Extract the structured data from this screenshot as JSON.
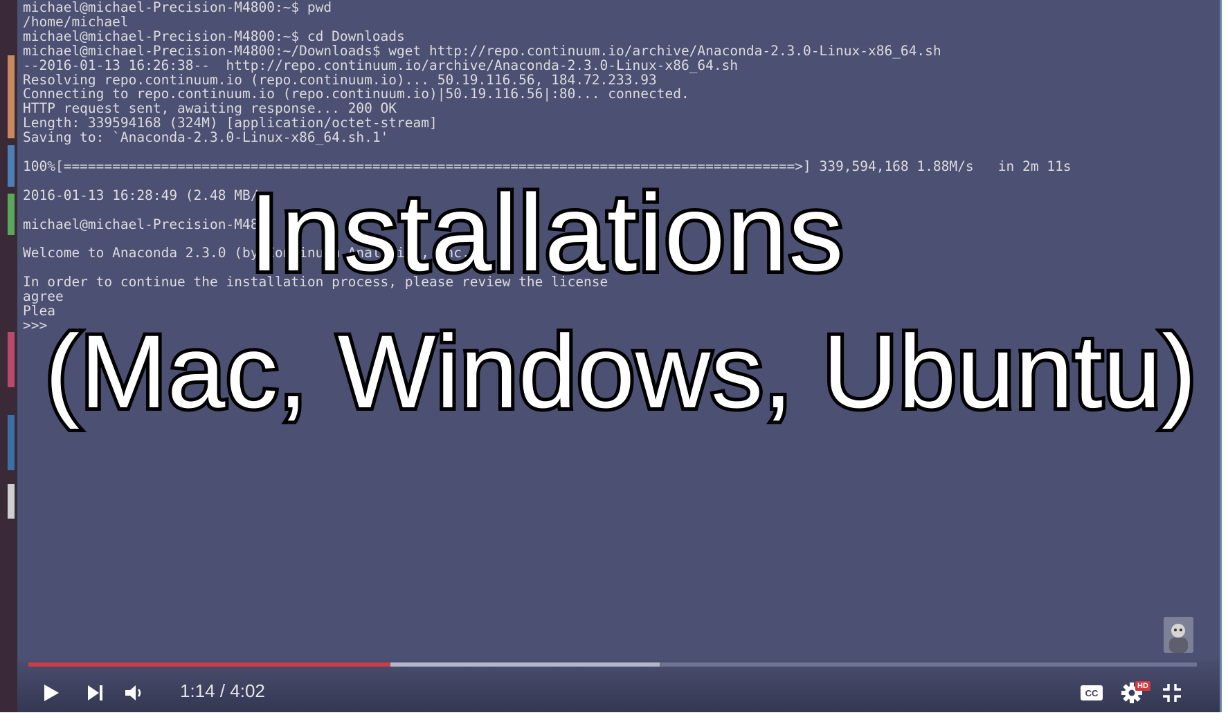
{
  "terminal": {
    "lines": [
      "michael@michael-Precision-M4800:~$ pwd",
      "/home/michael",
      "michael@michael-Precision-M4800:~$ cd Downloads",
      "michael@michael-Precision-M4800:~/Downloads$ wget http://repo.continuum.io/archive/Anaconda-2.3.0-Linux-x86_64.sh",
      "--2016-01-13 16:26:38--  http://repo.continuum.io/archive/Anaconda-2.3.0-Linux-x86_64.sh",
      "Resolving repo.continuum.io (repo.continuum.io)... 50.19.116.56, 184.72.233.93",
      "Connecting to repo.continuum.io (repo.continuum.io)|50.19.116.56|:80... connected.",
      "HTTP request sent, awaiting response... 200 OK",
      "Length: 339594168 (324M) [application/octet-stream]",
      "Saving to: `Anaconda-2.3.0-Linux-x86_64.sh.1'",
      "",
      "100%[==========================================================================================>] 339,594,168 1.88M/s   in 2m 11s",
      "",
      "2016-01-13 16:28:49 (2.48 MB/",
      "",
      "michael@michael-Precision-M48",
      "",
      "Welcome to Anaconda 2.3.0 (by Continuum Analytics, Inc.)",
      "",
      "In order to continue the installation process, please review the license",
      "agree",
      "Plea",
      ">>>"
    ]
  },
  "overlay": {
    "line1": "Installations",
    "line2": "(Mac, Windows, Ubuntu)"
  },
  "player": {
    "current_time": "1:14",
    "duration": "4:02",
    "time_display": "1:14 / 4:02",
    "played_fraction": 0.31,
    "buffered_fraction": 0.54,
    "hd_badge": "HD",
    "icons": {
      "play": "play-icon",
      "next": "next-icon",
      "volume": "volume-icon",
      "captions": "captions-icon",
      "settings": "settings-icon",
      "exit_fullscreen": "exit-fullscreen-icon"
    },
    "colors": {
      "played": "#cc3c45",
      "buffered": "#b3b6c6",
      "track": "#6f7392",
      "background": "#4c5072"
    }
  }
}
